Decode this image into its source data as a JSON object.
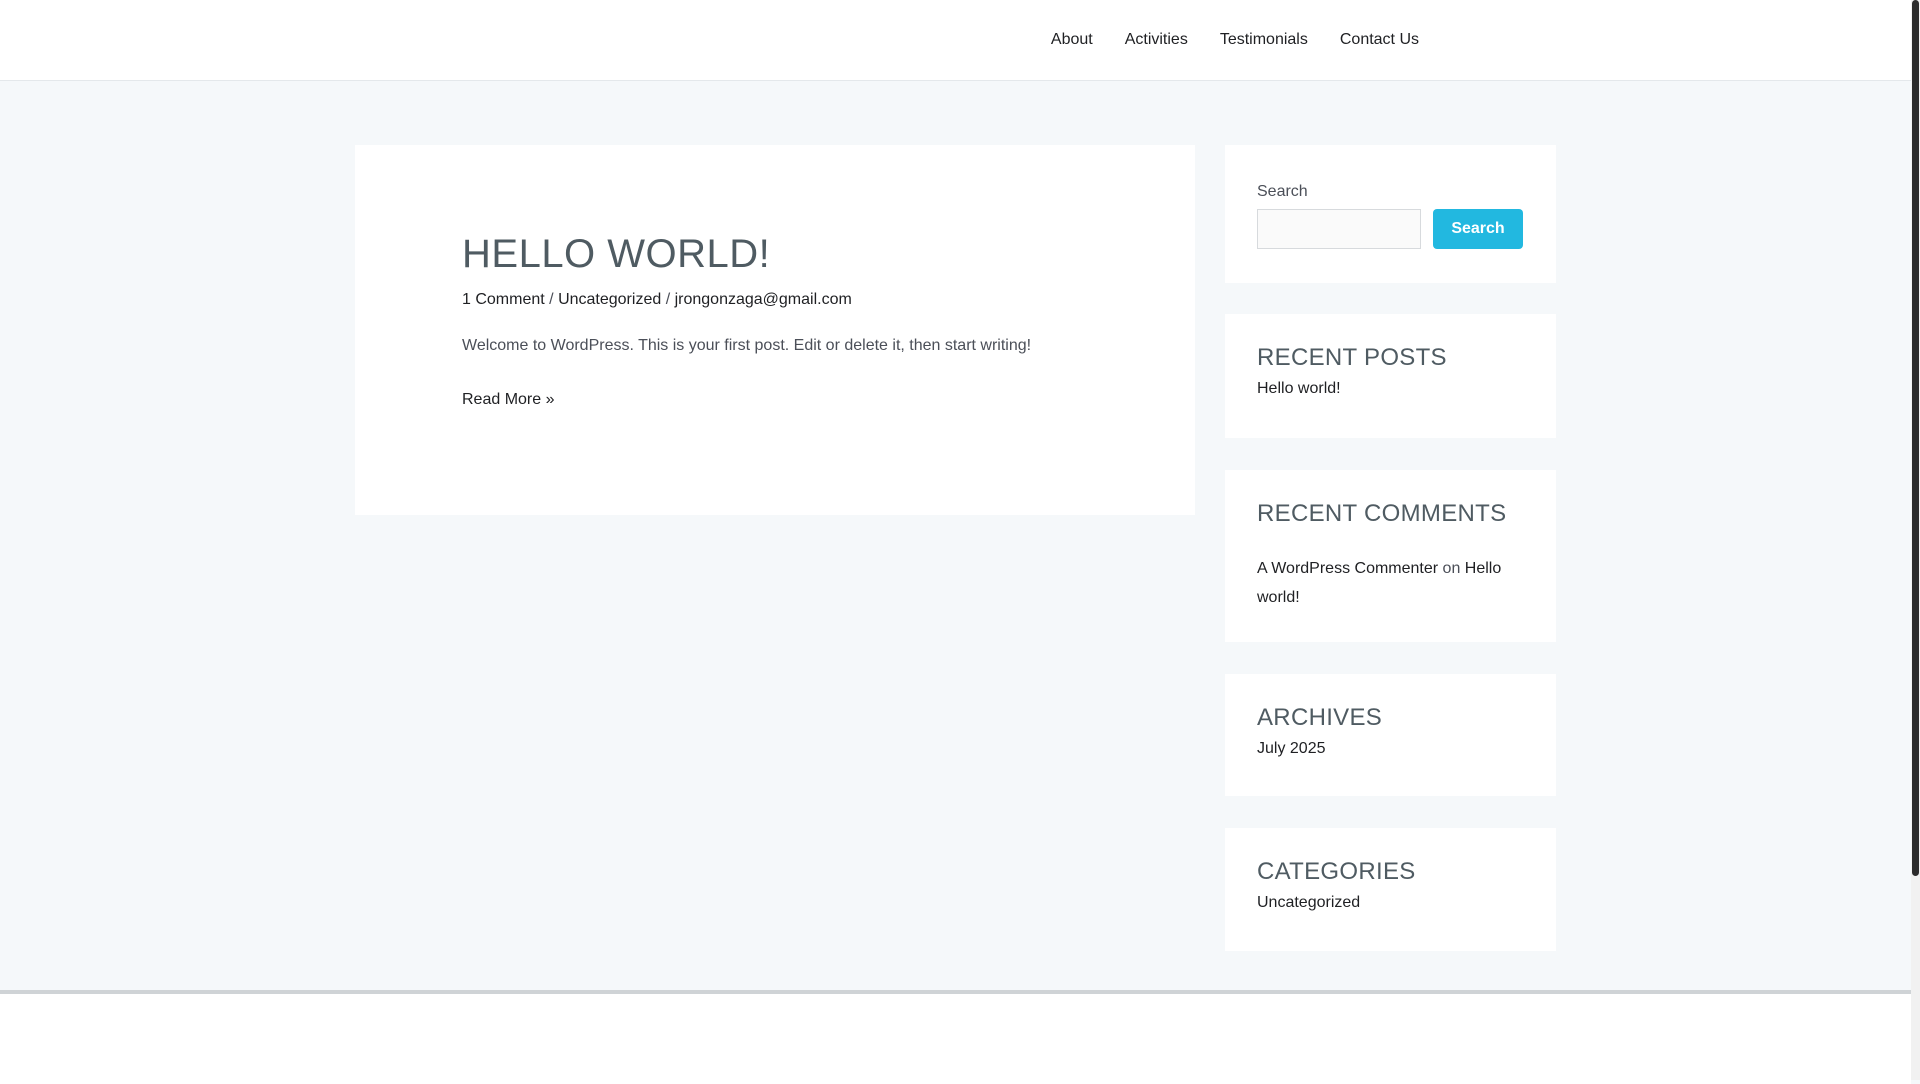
{
  "nav": {
    "about": "About",
    "activities": "Activities",
    "testimonials": "Testimonials",
    "contact": "Contact Us"
  },
  "post": {
    "title": "HELLO WORLD!",
    "meta": {
      "comments": "1 Comment",
      "separator": "/",
      "category": "Uncategorized",
      "author": "jrongonzaga@gmail.com"
    },
    "excerpt": "Welcome to WordPress. This is your first post. Edit or delete it, then start writing!",
    "read_more": "Read More »"
  },
  "sidebar": {
    "search": {
      "label": "Search",
      "placeholder": "",
      "button": "Search"
    },
    "recent_posts": {
      "title": "RECENT POSTS",
      "items": [
        "Hello world!"
      ]
    },
    "recent_comments": {
      "title": "RECENT COMMENTS",
      "author": "A WordPress Commenter",
      "on": "on",
      "post_line1": "Hello",
      "post_line2": "world!"
    },
    "archives": {
      "title": "ARCHIVES",
      "items": [
        "July 2025"
      ]
    },
    "categories": {
      "title": "CATEGORIES",
      "items": [
        "Uncategorized"
      ]
    }
  },
  "colors": {
    "accent": "#22b8e0",
    "page_background": "#f5f8fa",
    "heading": "#4f5b62"
  }
}
